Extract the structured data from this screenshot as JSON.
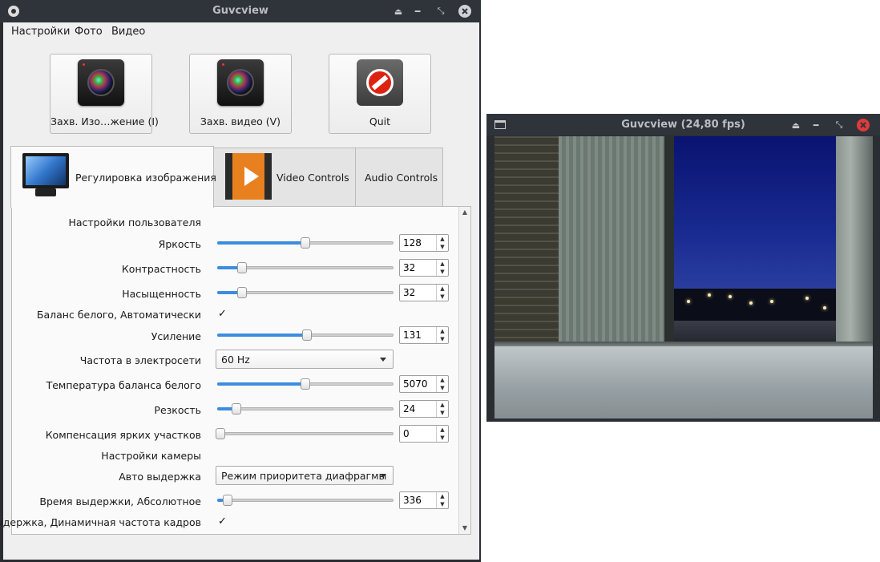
{
  "main_window": {
    "title": "Guvcview",
    "menu": [
      "Настройки",
      "Фото",
      "Видео"
    ],
    "buttons": {
      "capture_image": "Захв. Изо…жение (I)",
      "capture_video": "Захв. видео (V)",
      "quit": "Quit"
    },
    "tabs": [
      "Регулировка изображения",
      "Video Controls",
      "Audio Controls"
    ],
    "controls": {
      "user_settings_header": "Настройки пользователя",
      "brightness": {
        "label": "Яркость",
        "value": "128",
        "fraction": 0.5
      },
      "contrast": {
        "label": "Контрастность",
        "value": "32",
        "fraction": 0.14
      },
      "saturation": {
        "label": "Насыщенность",
        "value": "32",
        "fraction": 0.14
      },
      "white_balance_auto": {
        "label": "Баланс белого, Автоматически",
        "checked": true
      },
      "gain": {
        "label": "Усиление",
        "value": "131",
        "fraction": 0.51
      },
      "power_line_frequency": {
        "label": "Частота в электросети",
        "selected": "60 Hz"
      },
      "white_balance_temperature": {
        "label": "Температура баланса белого",
        "value": "5070",
        "fraction": 0.5
      },
      "sharpness": {
        "label": "Резкость",
        "value": "24",
        "fraction": 0.11
      },
      "backlight_compensation": {
        "label": "Компенсация ярких участков",
        "value": "0",
        "fraction": 0.02
      },
      "camera_settings_header": "Настройки камеры",
      "auto_exposure": {
        "label": "Авто выдержка",
        "selected": "Режим приоритета диафрагмы"
      },
      "exposure_absolute": {
        "label": "Время выдержки, Абсолютное",
        "value": "336",
        "fraction": 0.06
      },
      "exposure_dynamic_framerate": {
        "label": "Выдержка, Динамичная частота кадров",
        "checked": true
      }
    }
  },
  "preview_window": {
    "title": "Guvcview  (24,80 fps)"
  },
  "colors": {
    "accent": "#3c8de0",
    "titlebar": "#2f343a",
    "close_red": "#e03a3a"
  },
  "icons": [
    "app-icon",
    "camera-icon",
    "quit-icon",
    "monitor-icon",
    "film-icon"
  ]
}
